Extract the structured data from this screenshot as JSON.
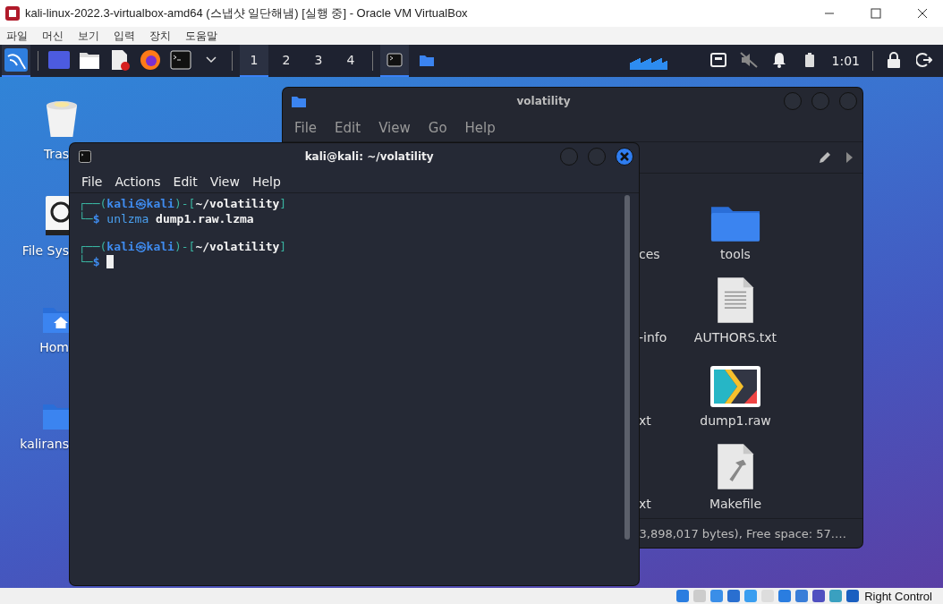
{
  "host_window": {
    "title": "kali-linux-2022.3-virtualbox-amd64 (스냅샷 일단해냄) [실행 중] - Oracle VM VirtualBox",
    "menu": [
      "파일",
      "머신",
      "보기",
      "입력",
      "장치",
      "도움말"
    ]
  },
  "panel": {
    "workspaces": [
      {
        "label": "1",
        "selected": true
      },
      {
        "label": "2",
        "selected": false
      },
      {
        "label": "3",
        "selected": false
      },
      {
        "label": "4",
        "selected": false
      }
    ],
    "tasks": [
      {
        "kind": "terminal",
        "selected": true
      },
      {
        "kind": "folder",
        "selected": false
      }
    ],
    "clock": "1:01"
  },
  "desktop_icons": [
    {
      "kind": "trash",
      "label": "Tras"
    },
    {
      "kind": "drive",
      "label": "File Sys"
    },
    {
      "kind": "home",
      "label": "Hom"
    },
    {
      "kind": "folder",
      "label": "kalirans"
    }
  ],
  "file_manager": {
    "title": "volatility",
    "menu": [
      "File",
      "Edit",
      "View",
      "Go",
      "Help"
    ],
    "partial_names": [
      "ces",
      "-info",
      "xt",
      "xt"
    ],
    "files": [
      {
        "kind": "folder",
        "name": "tools"
      },
      {
        "kind": "text",
        "name": "AUTHORS.txt"
      },
      {
        "kind": "media",
        "name": "dump1.raw"
      },
      {
        "kind": "makefile",
        "name": "Makefile"
      }
    ],
    "status": "3,898,017 bytes), Free space: 57.…"
  },
  "terminal": {
    "title": "kali@kali: ~/volatility",
    "menu": [
      "File",
      "Actions",
      "Edit",
      "View",
      "Help"
    ],
    "prompts": [
      {
        "top": [
          {
            "kind": "frame",
            "text": "┌──("
          },
          {
            "kind": "user",
            "text": "kali㉿kali"
          },
          {
            "kind": "frame",
            "text": ")-["
          },
          {
            "kind": "dir",
            "text": "~/volatility"
          },
          {
            "kind": "frame",
            "text": "]"
          }
        ],
        "bottom": [
          {
            "kind": "frame",
            "text": "└─"
          },
          {
            "kind": "user",
            "text": "$"
          },
          {
            "kind": "cmd",
            "text": " unlzma"
          },
          {
            "kind": "arg",
            "text": " dump1.raw.lzma"
          }
        ],
        "cursor": false
      },
      {
        "top": [
          {
            "kind": "frame",
            "text": "┌──("
          },
          {
            "kind": "user",
            "text": "kali㉿kali"
          },
          {
            "kind": "frame",
            "text": ")-["
          },
          {
            "kind": "dir",
            "text": "~/volatility"
          },
          {
            "kind": "frame",
            "text": "]"
          }
        ],
        "bottom": [
          {
            "kind": "frame",
            "text": "└─"
          },
          {
            "kind": "user",
            "text": "$"
          }
        ],
        "cursor": true
      }
    ]
  },
  "vbox_status": {
    "host_key": "Right Control"
  }
}
